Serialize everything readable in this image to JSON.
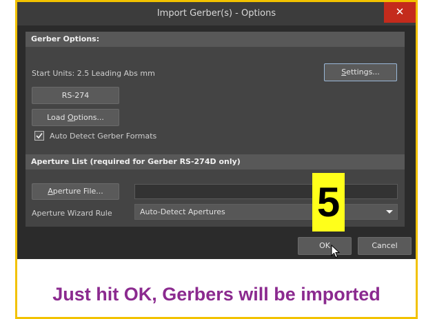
{
  "window": {
    "title": "Import Gerber(s) - Options",
    "close_glyph": "✕"
  },
  "gerber_options": {
    "header": "Gerber Options:",
    "start_units": "Start Units: 2.5 Leading Abs mm",
    "settings_button": {
      "before": "",
      "accel": "S",
      "after": "ettings..."
    },
    "format_button": "RS-274",
    "load_options_button": {
      "before": "Load ",
      "accel": "O",
      "after": "ptions..."
    },
    "auto_detect_checkbox": {
      "label": "Auto Detect Gerber Formats",
      "checked": true
    }
  },
  "aperture_list": {
    "header": "Aperture List (required for Gerber RS-274D only)",
    "aperture_file_button": {
      "before": "",
      "accel": "A",
      "after": "perture File..."
    },
    "aperture_file_value": "",
    "wizard_rule_label": "Aperture Wizard Rule",
    "wizard_rule_value": "Auto-Detect Apertures"
  },
  "footer": {
    "ok_label": "OK",
    "cancel_label": "Cancel"
  },
  "annotation": {
    "step_number": "5",
    "caption": "Just hit OK, Gerbers will be imported"
  },
  "colors": {
    "highlight_border": "#f2c200",
    "badge": "#ffff1a",
    "caption": "#8b2a8f",
    "close": "#c42b1c"
  },
  "icons": [
    "close-icon",
    "checkmark-icon",
    "dropdown-arrow-icon",
    "mouse-pointer-icon"
  ]
}
